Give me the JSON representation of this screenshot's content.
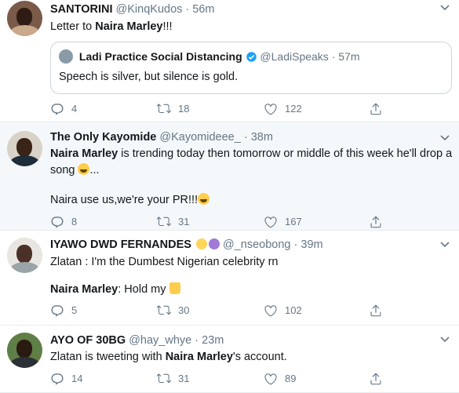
{
  "tweets": [
    {
      "name": "SANTORINI",
      "handle": "@KinqKudos",
      "dot": "·",
      "time": "56m",
      "line1_pre": "Letter to ",
      "line1_bold": "Naira Marley",
      "line1_post": "!!!",
      "quote": {
        "name": "Ladi Practice Social Distancing",
        "handle": "@LadiSpeaks",
        "dot": "·",
        "time": "57m",
        "text": "Speech is silver, but silence is gold."
      },
      "replies": "4",
      "retweets": "18",
      "likes": "122"
    },
    {
      "name": "The Only Kayomide",
      "handle": "@Kayomideee_",
      "dot": "·",
      "time": "38m",
      "line1_bold": "Naira Marley",
      "line1_post": " is trending today then tomorrow or middle of this week he'll drop a",
      "line2": "song",
      "line2_post": "...",
      "line3": "Naira use us,we're your PR!!!",
      "replies": "8",
      "retweets": "31",
      "likes": "167"
    },
    {
      "name": "IYAWO DWD FERNANDES",
      "handle": "@_nseobong",
      "dot": "·",
      "time": "39m",
      "line1": "Zlatan : I'm the Dumbest Nigerian celebrity rn",
      "line2_bold": "Naira Marley",
      "line2_post": ": Hold my",
      "replies": "5",
      "retweets": "30",
      "likes": "102"
    },
    {
      "name": "AYO OF 30BG",
      "handle": "@hay_whye",
      "dot": "·",
      "time": "23m",
      "line1_pre": "Zlatan is tweeting with ",
      "line1_bold": "Naira Marley",
      "line1_post": "'s account.",
      "replies": "14",
      "retweets": "31",
      "likes": "89"
    }
  ],
  "colors": {
    "secondary_text": "#657786",
    "divider": "#e6ecf0",
    "highlight_bg": "#f5f8fa",
    "verified_blue": "#1da1f2",
    "icon": "#657786"
  },
  "icons": [
    "reply-icon",
    "retweet-icon",
    "like-icon",
    "share-icon",
    "chevron-down-icon",
    "verified-icon"
  ]
}
